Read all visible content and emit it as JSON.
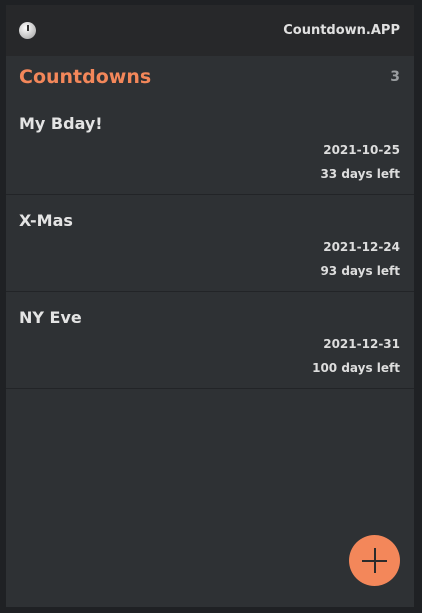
{
  "header": {
    "icon": "clock-icon",
    "brand": "Countdown.APP"
  },
  "list": {
    "title": "Countdowns",
    "count": "3",
    "items": [
      {
        "name": "My Bday!",
        "date": "2021-10-25",
        "left": "33 days left"
      },
      {
        "name": "X-Mas",
        "date": "2021-12-24",
        "left": "93 days left"
      },
      {
        "name": "NY Eve",
        "date": "2021-12-31",
        "left": "100 days left"
      }
    ]
  },
  "fab": {
    "icon": "plus-icon",
    "accent": "#f3875a"
  }
}
